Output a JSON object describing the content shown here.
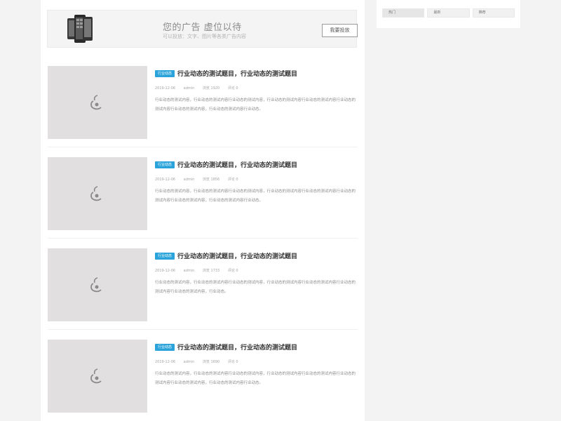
{
  "sidebar": {
    "tabs": [
      {
        "label": "热门"
      },
      {
        "label": "最新"
      },
      {
        "label": "推荐"
      }
    ]
  },
  "ad": {
    "title": "您的广告 虚位以待",
    "subtitle": "可以投放：文字、图片等各类广告内容",
    "button": "我要投放"
  },
  "colors": {
    "accent": "#29a3da",
    "page_bg": "#f3f3f3",
    "thumb_bg": "#e1dfe0"
  },
  "posts": [
    {
      "category": "行业动态",
      "title": "行业动态的测试题目，行业动态的测试题目",
      "meta": {
        "date": "2019-12-06",
        "author": "admin",
        "views": "浏览 1920",
        "comments": "评论 0"
      },
      "excerpt": "行业动态的测试内容，行业动态的测试内容行业动态的测试内容，行业动态的测试内容行业动态的测试内容行业动态的测试内容行业动态的测试内容，行业动态的测试内容行业动态。"
    },
    {
      "category": "行业动态",
      "title": "行业动态的测试题目，行业动态的测试题目",
      "meta": {
        "date": "2019-12-06",
        "author": "admin",
        "views": "浏览 1856",
        "comments": "评论 0"
      },
      "excerpt": "行业动态的测试内容，行业动态的测试内容行业动态的测试内容，行业动态的测试内容行业动态的测试内容行业动态的测试内容行业动态的测试内容，行业动态的测试内容行业动态。"
    },
    {
      "category": "行业动态",
      "title": "行业动态的测试题目，行业动态的测试题目",
      "meta": {
        "date": "2019-12-06",
        "author": "admin",
        "views": "浏览 1733",
        "comments": "评论 0"
      },
      "excerpt": "行业动态的测试内容，行业动态的测试内容行业动态的测试内容，行业动态的测试内容行业动态的测试内容行业动态的测试内容行业动态的测试内容，行业动态。"
    },
    {
      "category": "行业动态",
      "title": "行业动态的测试题目，行业动态的测试题目",
      "meta": {
        "date": "2019-12-06",
        "author": "admin",
        "views": "浏览 1690",
        "comments": "评论 0"
      },
      "excerpt": "行业动态的测试内容，行业动态的测试内容行业动态的测试内容，行业动态的测试内容行业动态的测试内容行业动态的测试内容行业动态的测试内容，行业动态的测试内容行业动态。"
    }
  ]
}
